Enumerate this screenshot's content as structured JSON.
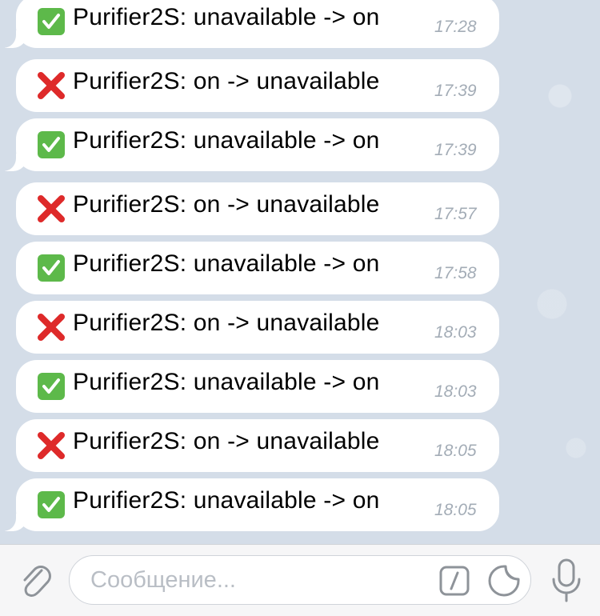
{
  "messages": [
    {
      "status": "ok",
      "text": "Purifier2S: unavailable -> on",
      "time": "17:28"
    },
    {
      "status": "error",
      "text": "Purifier2S: on -> unavailable",
      "time": "17:39"
    },
    {
      "status": "ok",
      "text": "Purifier2S: unavailable -> on",
      "time": "17:39"
    },
    {
      "status": "error",
      "text": "Purifier2S: on -> unavailable",
      "time": "17:57"
    },
    {
      "status": "ok",
      "text": "Purifier2S: unavailable -> on",
      "time": "17:58"
    },
    {
      "status": "error",
      "text": "Purifier2S: on -> unavailable",
      "time": "18:03"
    },
    {
      "status": "ok",
      "text": "Purifier2S: unavailable -> on",
      "time": "18:03"
    },
    {
      "status": "error",
      "text": "Purifier2S: on -> unavailable",
      "time": "18:05"
    },
    {
      "status": "ok",
      "text": "Purifier2S: unavailable -> on",
      "time": "18:05"
    }
  ],
  "icons": {
    "ok": "check-mark-button-icon",
    "error": "cross-mark-icon",
    "attach": "paperclip-icon",
    "commands": "slash-command-icon",
    "sticker": "sticker-icon",
    "mic": "microphone-icon"
  },
  "colors": {
    "background": "#d4dde8",
    "check_green": "#5db94a",
    "cross_red": "#de2a2a",
    "time_gray": "#a3acb6"
  },
  "input": {
    "placeholder": "Сообщение..."
  }
}
